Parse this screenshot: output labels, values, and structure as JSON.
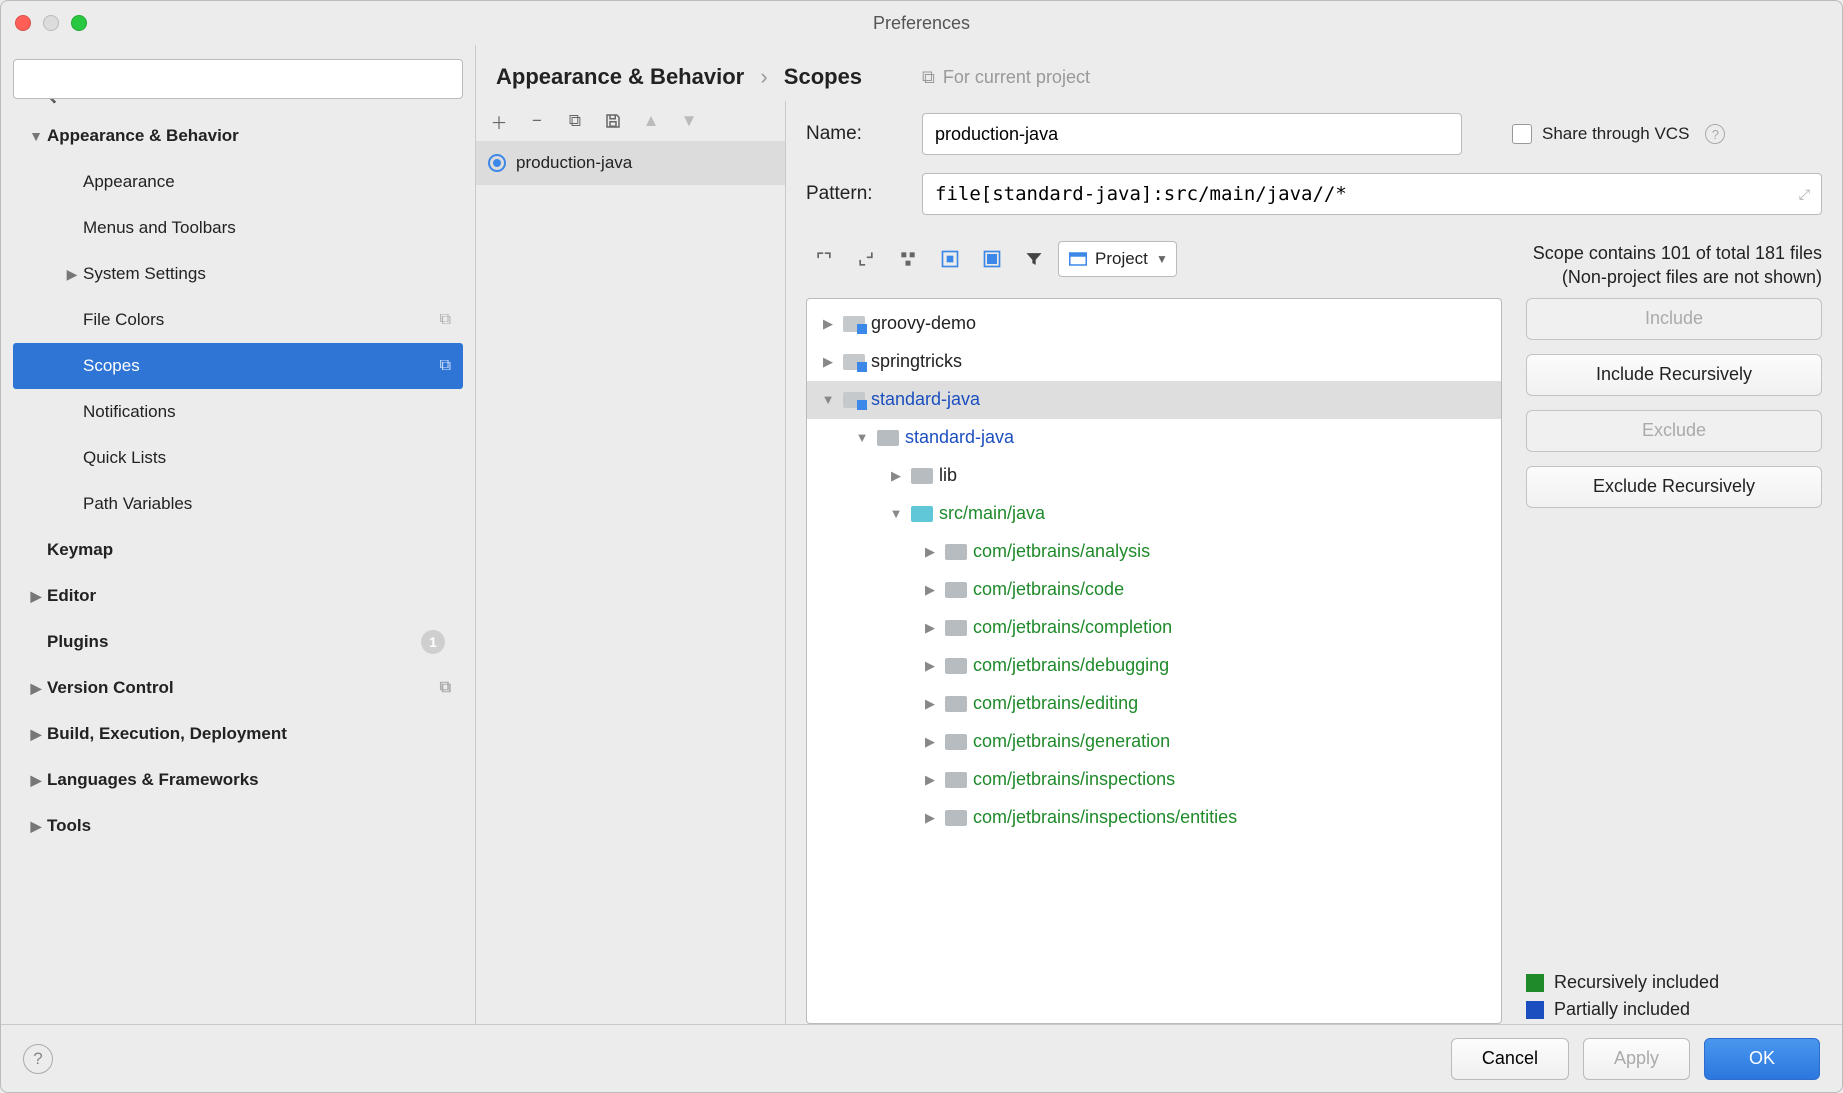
{
  "window": {
    "title": "Preferences"
  },
  "sidebar": {
    "search_placeholder": "",
    "items": [
      {
        "label": "Appearance & Behavior",
        "bold": true,
        "twisty": "down",
        "indent": 1
      },
      {
        "label": "Appearance",
        "indent": 2
      },
      {
        "label": "Menus and Toolbars",
        "indent": 2
      },
      {
        "label": "System Settings",
        "twisty": "right",
        "indent": 2
      },
      {
        "label": "File Colors",
        "indent": 2,
        "badge": "copy"
      },
      {
        "label": "Scopes",
        "indent": 2,
        "selected": true,
        "badge": "copy"
      },
      {
        "label": "Notifications",
        "indent": 2
      },
      {
        "label": "Quick Lists",
        "indent": 2
      },
      {
        "label": "Path Variables",
        "indent": 2
      },
      {
        "label": "Keymap",
        "bold": true,
        "indent": 1
      },
      {
        "label": "Editor",
        "bold": true,
        "twisty": "right",
        "indent": 1
      },
      {
        "label": "Plugins",
        "bold": true,
        "indent": 1,
        "count": "1"
      },
      {
        "label": "Version Control",
        "bold": true,
        "twisty": "right",
        "indent": 1,
        "badge": "copy"
      },
      {
        "label": "Build, Execution, Deployment",
        "bold": true,
        "twisty": "right",
        "indent": 1
      },
      {
        "label": "Languages & Frameworks",
        "bold": true,
        "twisty": "right",
        "indent": 1
      },
      {
        "label": "Tools",
        "bold": true,
        "twisty": "right",
        "indent": 1
      }
    ]
  },
  "breadcrumb": {
    "root": "Appearance & Behavior",
    "leaf": "Scopes",
    "for_project": "For current project"
  },
  "scope_list": {
    "items": [
      {
        "label": "production-java",
        "selected": true
      }
    ]
  },
  "form": {
    "name_label": "Name:",
    "name_value": "production-java",
    "share_label": "Share through VCS",
    "pattern_label": "Pattern:",
    "pattern_value": "file[standard-java]:src/main/java//*"
  },
  "scope_toolbar": {
    "project_label": "Project"
  },
  "status": {
    "line1": "Scope contains 101 of total 181 files",
    "line2": "(Non-project files are not shown)"
  },
  "file_tree": [
    {
      "label": "groovy-demo",
      "indent": 0,
      "twisty": "right",
      "icon": "mod",
      "color": ""
    },
    {
      "label": "springtricks",
      "indent": 0,
      "twisty": "right",
      "icon": "mod",
      "color": ""
    },
    {
      "label": "standard-java",
      "indent": 0,
      "twisty": "down",
      "icon": "mod",
      "color": "blue",
      "selected": true
    },
    {
      "label": "standard-java",
      "indent": 1,
      "twisty": "down",
      "icon": "gray",
      "color": "blue"
    },
    {
      "label": "lib",
      "indent": 2,
      "twisty": "right",
      "icon": "gray",
      "color": ""
    },
    {
      "label": "src/main/java",
      "indent": 2,
      "twisty": "down",
      "icon": "teal",
      "color": "green"
    },
    {
      "label": "com/jetbrains/analysis",
      "indent": 3,
      "twisty": "right",
      "icon": "gray",
      "color": "green"
    },
    {
      "label": "com/jetbrains/code",
      "indent": 3,
      "twisty": "right",
      "icon": "gray",
      "color": "green"
    },
    {
      "label": "com/jetbrains/completion",
      "indent": 3,
      "twisty": "right",
      "icon": "gray",
      "color": "green"
    },
    {
      "label": "com/jetbrains/debugging",
      "indent": 3,
      "twisty": "right",
      "icon": "gray",
      "color": "green"
    },
    {
      "label": "com/jetbrains/editing",
      "indent": 3,
      "twisty": "right",
      "icon": "gray",
      "color": "green"
    },
    {
      "label": "com/jetbrains/generation",
      "indent": 3,
      "twisty": "right",
      "icon": "gray",
      "color": "green"
    },
    {
      "label": "com/jetbrains/inspections",
      "indent": 3,
      "twisty": "right",
      "icon": "gray",
      "color": "green"
    },
    {
      "label": "com/jetbrains/inspections/entities",
      "indent": 3,
      "twisty": "right",
      "icon": "gray",
      "color": "green"
    }
  ],
  "side_buttons": {
    "include": "Include",
    "include_rec": "Include Recursively",
    "exclude": "Exclude",
    "exclude_rec": "Exclude Recursively"
  },
  "legend": {
    "rec": "Recursively included",
    "part": "Partially included"
  },
  "footer": {
    "cancel": "Cancel",
    "apply": "Apply",
    "ok": "OK"
  }
}
